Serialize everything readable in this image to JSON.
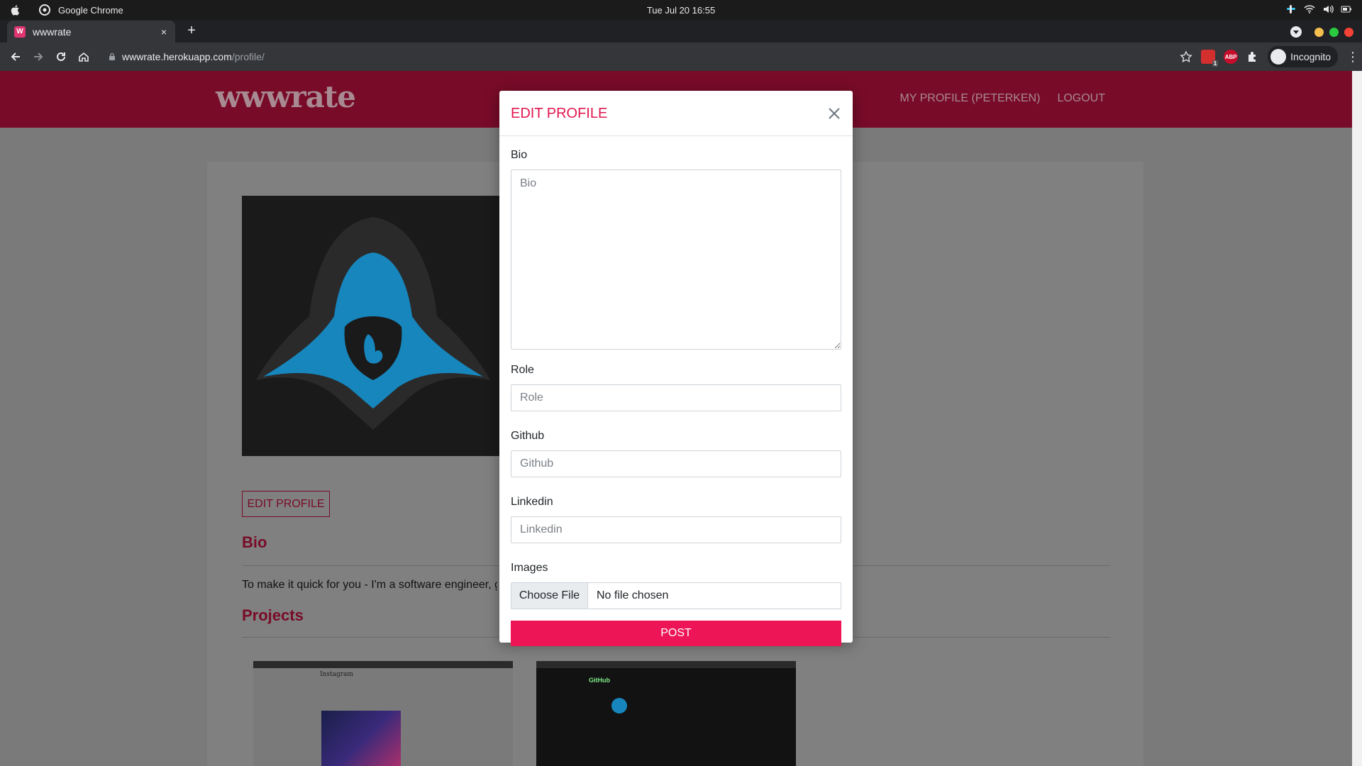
{
  "os": {
    "app_name": "Google Chrome",
    "clock": "Tue Jul 20  16:55"
  },
  "browser": {
    "tab_title": "wwwrate",
    "tab_favicon_letter": "W",
    "tab_close": "×",
    "new_tab": "+",
    "url_host": "wwwrate.herokuapp.com",
    "url_path": "/profile/",
    "ext_badge_count": "1",
    "ext_abp": "ABP",
    "incognito_label": "Incognito",
    "menu_icon": "⋮"
  },
  "site": {
    "brand": "wwwrate",
    "nav": {
      "my_profile": "MY PROFILE (PETERKEN)",
      "logout": "LOGOUT"
    },
    "edit_profile_button": "EDIT PROFILE",
    "bio_heading": "Bio",
    "bio_text": "To make it quick for you - I'm a software engineer, g",
    "projects_heading": "Projects",
    "project1_label": "Instagram",
    "project2_label": "GitHub"
  },
  "modal": {
    "title": "EDIT PROFILE",
    "fields": {
      "bio": {
        "label": "Bio",
        "placeholder": "Bio"
      },
      "role": {
        "label": "Role",
        "placeholder": "Role"
      },
      "github": {
        "label": "Github",
        "placeholder": "Github"
      },
      "linkedin": {
        "label": "Linkedin",
        "placeholder": "Linkedin"
      },
      "images": {
        "label": "Images",
        "button": "Choose File",
        "status": "No file chosen"
      }
    },
    "submit_label": "POST"
  },
  "colors": {
    "brand_dark": "#780b28",
    "accent": "#ed1555",
    "modal_title": "#e0174f"
  }
}
